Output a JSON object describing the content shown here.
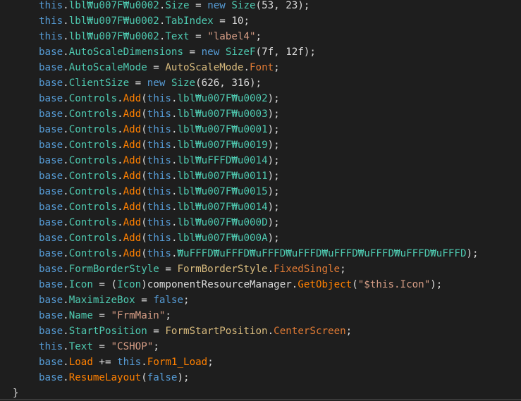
{
  "editor": {
    "lines": [
      [
        {
          "t": "this",
          "c": "kw"
        },
        {
          "t": ".",
          "c": "plain"
        },
        {
          "t": "lbl₩u007F₩u0002",
          "c": "member"
        },
        {
          "t": ".",
          "c": "plain"
        },
        {
          "t": "Size",
          "c": "prop"
        },
        {
          "t": " = ",
          "c": "plain"
        },
        {
          "t": "new",
          "c": "kw"
        },
        {
          "t": " ",
          "c": "plain"
        },
        {
          "t": "Size",
          "c": "type"
        },
        {
          "t": "(53, 23);",
          "c": "plain"
        }
      ],
      [
        {
          "t": "this",
          "c": "kw"
        },
        {
          "t": ".",
          "c": "plain"
        },
        {
          "t": "lbl₩u007F₩u0002",
          "c": "member"
        },
        {
          "t": ".",
          "c": "plain"
        },
        {
          "t": "TabIndex",
          "c": "prop"
        },
        {
          "t": " = 10;",
          "c": "plain"
        }
      ],
      [
        {
          "t": "this",
          "c": "kw"
        },
        {
          "t": ".",
          "c": "plain"
        },
        {
          "t": "lbl₩u007F₩u0002",
          "c": "member"
        },
        {
          "t": ".",
          "c": "plain"
        },
        {
          "t": "Text",
          "c": "prop"
        },
        {
          "t": " = ",
          "c": "plain"
        },
        {
          "t": "\"label4\"",
          "c": "str"
        },
        {
          "t": ";",
          "c": "plain"
        }
      ],
      [
        {
          "t": "base",
          "c": "kw"
        },
        {
          "t": ".",
          "c": "plain"
        },
        {
          "t": "AutoScaleDimensions",
          "c": "prop"
        },
        {
          "t": " = ",
          "c": "plain"
        },
        {
          "t": "new",
          "c": "kw"
        },
        {
          "t": " ",
          "c": "plain"
        },
        {
          "t": "SizeF",
          "c": "type"
        },
        {
          "t": "(7f, 12f);",
          "c": "plain"
        }
      ],
      [
        {
          "t": "base",
          "c": "kw"
        },
        {
          "t": ".",
          "c": "plain"
        },
        {
          "t": "AutoScaleMode",
          "c": "prop"
        },
        {
          "t": " = ",
          "c": "plain"
        },
        {
          "t": "AutoScaleMode",
          "c": "ref"
        },
        {
          "t": ".",
          "c": "plain"
        },
        {
          "t": "Font",
          "c": "enum"
        },
        {
          "t": ";",
          "c": "plain"
        }
      ],
      [
        {
          "t": "base",
          "c": "kw"
        },
        {
          "t": ".",
          "c": "plain"
        },
        {
          "t": "ClientSize",
          "c": "prop"
        },
        {
          "t": " = ",
          "c": "plain"
        },
        {
          "t": "new",
          "c": "kw"
        },
        {
          "t": " ",
          "c": "plain"
        },
        {
          "t": "Size",
          "c": "type"
        },
        {
          "t": "(626, 316);",
          "c": "plain"
        }
      ],
      [
        {
          "t": "base",
          "c": "kw"
        },
        {
          "t": ".",
          "c": "plain"
        },
        {
          "t": "Controls",
          "c": "prop"
        },
        {
          "t": ".",
          "c": "plain"
        },
        {
          "t": "Add",
          "c": "method"
        },
        {
          "t": "(",
          "c": "plain"
        },
        {
          "t": "this",
          "c": "kw"
        },
        {
          "t": ".",
          "c": "plain"
        },
        {
          "t": "lbl₩u007F₩u0002",
          "c": "member"
        },
        {
          "t": ");",
          "c": "plain"
        }
      ],
      [
        {
          "t": "base",
          "c": "kw"
        },
        {
          "t": ".",
          "c": "plain"
        },
        {
          "t": "Controls",
          "c": "prop"
        },
        {
          "t": ".",
          "c": "plain"
        },
        {
          "t": "Add",
          "c": "method"
        },
        {
          "t": "(",
          "c": "plain"
        },
        {
          "t": "this",
          "c": "kw"
        },
        {
          "t": ".",
          "c": "plain"
        },
        {
          "t": "lbl₩u007F₩u0003",
          "c": "member"
        },
        {
          "t": ");",
          "c": "plain"
        }
      ],
      [
        {
          "t": "base",
          "c": "kw"
        },
        {
          "t": ".",
          "c": "plain"
        },
        {
          "t": "Controls",
          "c": "prop"
        },
        {
          "t": ".",
          "c": "plain"
        },
        {
          "t": "Add",
          "c": "method"
        },
        {
          "t": "(",
          "c": "plain"
        },
        {
          "t": "this",
          "c": "kw"
        },
        {
          "t": ".",
          "c": "plain"
        },
        {
          "t": "lbl₩u007F₩u0001",
          "c": "member"
        },
        {
          "t": ");",
          "c": "plain"
        }
      ],
      [
        {
          "t": "base",
          "c": "kw"
        },
        {
          "t": ".",
          "c": "plain"
        },
        {
          "t": "Controls",
          "c": "prop"
        },
        {
          "t": ".",
          "c": "plain"
        },
        {
          "t": "Add",
          "c": "method"
        },
        {
          "t": "(",
          "c": "plain"
        },
        {
          "t": "this",
          "c": "kw"
        },
        {
          "t": ".",
          "c": "plain"
        },
        {
          "t": "lbl₩u007F₩u0019",
          "c": "member"
        },
        {
          "t": ");",
          "c": "plain"
        }
      ],
      [
        {
          "t": "base",
          "c": "kw"
        },
        {
          "t": ".",
          "c": "plain"
        },
        {
          "t": "Controls",
          "c": "prop"
        },
        {
          "t": ".",
          "c": "plain"
        },
        {
          "t": "Add",
          "c": "method"
        },
        {
          "t": "(",
          "c": "plain"
        },
        {
          "t": "this",
          "c": "kw"
        },
        {
          "t": ".",
          "c": "plain"
        },
        {
          "t": "lbl₩uFFFD₩u0014",
          "c": "member"
        },
        {
          "t": ");",
          "c": "plain"
        }
      ],
      [
        {
          "t": "base",
          "c": "kw"
        },
        {
          "t": ".",
          "c": "plain"
        },
        {
          "t": "Controls",
          "c": "prop"
        },
        {
          "t": ".",
          "c": "plain"
        },
        {
          "t": "Add",
          "c": "method"
        },
        {
          "t": "(",
          "c": "plain"
        },
        {
          "t": "this",
          "c": "kw"
        },
        {
          "t": ".",
          "c": "plain"
        },
        {
          "t": "lbl₩u007F₩u0011",
          "c": "member"
        },
        {
          "t": ");",
          "c": "plain"
        }
      ],
      [
        {
          "t": "base",
          "c": "kw"
        },
        {
          "t": ".",
          "c": "plain"
        },
        {
          "t": "Controls",
          "c": "prop"
        },
        {
          "t": ".",
          "c": "plain"
        },
        {
          "t": "Add",
          "c": "method"
        },
        {
          "t": "(",
          "c": "plain"
        },
        {
          "t": "this",
          "c": "kw"
        },
        {
          "t": ".",
          "c": "plain"
        },
        {
          "t": "lbl₩u007F₩u0015",
          "c": "member"
        },
        {
          "t": ");",
          "c": "plain"
        }
      ],
      [
        {
          "t": "base",
          "c": "kw"
        },
        {
          "t": ".",
          "c": "plain"
        },
        {
          "t": "Controls",
          "c": "prop"
        },
        {
          "t": ".",
          "c": "plain"
        },
        {
          "t": "Add",
          "c": "method"
        },
        {
          "t": "(",
          "c": "plain"
        },
        {
          "t": "this",
          "c": "kw"
        },
        {
          "t": ".",
          "c": "plain"
        },
        {
          "t": "lbl₩u007F₩u0014",
          "c": "member"
        },
        {
          "t": ");",
          "c": "plain"
        }
      ],
      [
        {
          "t": "base",
          "c": "kw"
        },
        {
          "t": ".",
          "c": "plain"
        },
        {
          "t": "Controls",
          "c": "prop"
        },
        {
          "t": ".",
          "c": "plain"
        },
        {
          "t": "Add",
          "c": "method"
        },
        {
          "t": "(",
          "c": "plain"
        },
        {
          "t": "this",
          "c": "kw"
        },
        {
          "t": ".",
          "c": "plain"
        },
        {
          "t": "lbl₩u007F₩u000D",
          "c": "member"
        },
        {
          "t": ");",
          "c": "plain"
        }
      ],
      [
        {
          "t": "base",
          "c": "kw"
        },
        {
          "t": ".",
          "c": "plain"
        },
        {
          "t": "Controls",
          "c": "prop"
        },
        {
          "t": ".",
          "c": "plain"
        },
        {
          "t": "Add",
          "c": "method"
        },
        {
          "t": "(",
          "c": "plain"
        },
        {
          "t": "this",
          "c": "kw"
        },
        {
          "t": ".",
          "c": "plain"
        },
        {
          "t": "lbl₩u007F₩u000A",
          "c": "member"
        },
        {
          "t": ");",
          "c": "plain"
        }
      ],
      [
        {
          "t": "base",
          "c": "kw"
        },
        {
          "t": ".",
          "c": "plain"
        },
        {
          "t": "Controls",
          "c": "prop"
        },
        {
          "t": ".",
          "c": "plain"
        },
        {
          "t": "Add",
          "c": "method"
        },
        {
          "t": "(",
          "c": "plain"
        },
        {
          "t": "this",
          "c": "kw"
        },
        {
          "t": ".",
          "c": "plain"
        },
        {
          "t": "₩uFFFD₩uFFFD₩uFFFD₩uFFFD₩uFFFD₩uFFFD₩uFFFD₩uFFFD",
          "c": "member"
        },
        {
          "t": ");",
          "c": "plain"
        }
      ],
      [
        {
          "t": "base",
          "c": "kw"
        },
        {
          "t": ".",
          "c": "plain"
        },
        {
          "t": "FormBorderStyle",
          "c": "prop"
        },
        {
          "t": " = ",
          "c": "plain"
        },
        {
          "t": "FormBorderStyle",
          "c": "ref"
        },
        {
          "t": ".",
          "c": "plain"
        },
        {
          "t": "FixedSingle",
          "c": "enum"
        },
        {
          "t": ";",
          "c": "plain"
        }
      ],
      [
        {
          "t": "base",
          "c": "kw"
        },
        {
          "t": ".",
          "c": "plain"
        },
        {
          "t": "Icon",
          "c": "prop"
        },
        {
          "t": " = (",
          "c": "plain"
        },
        {
          "t": "Icon",
          "c": "type"
        },
        {
          "t": ")componentResourceManager.",
          "c": "plain"
        },
        {
          "t": "GetObject",
          "c": "method"
        },
        {
          "t": "(",
          "c": "plain"
        },
        {
          "t": "\"$this.Icon\"",
          "c": "str"
        },
        {
          "t": ");",
          "c": "plain"
        }
      ],
      [
        {
          "t": "base",
          "c": "kw"
        },
        {
          "t": ".",
          "c": "plain"
        },
        {
          "t": "MaximizeBox",
          "c": "prop"
        },
        {
          "t": " = ",
          "c": "plain"
        },
        {
          "t": "false",
          "c": "kw"
        },
        {
          "t": ";",
          "c": "plain"
        }
      ],
      [
        {
          "t": "base",
          "c": "kw"
        },
        {
          "t": ".",
          "c": "plain"
        },
        {
          "t": "Name",
          "c": "prop"
        },
        {
          "t": " = ",
          "c": "plain"
        },
        {
          "t": "\"FrmMain\"",
          "c": "str"
        },
        {
          "t": ";",
          "c": "plain"
        }
      ],
      [
        {
          "t": "base",
          "c": "kw"
        },
        {
          "t": ".",
          "c": "plain"
        },
        {
          "t": "StartPosition",
          "c": "prop"
        },
        {
          "t": " = ",
          "c": "plain"
        },
        {
          "t": "FormStartPosition",
          "c": "ref"
        },
        {
          "t": ".",
          "c": "plain"
        },
        {
          "t": "CenterScreen",
          "c": "enum"
        },
        {
          "t": ";",
          "c": "plain"
        }
      ],
      [
        {
          "t": "this",
          "c": "kw"
        },
        {
          "t": ".",
          "c": "plain"
        },
        {
          "t": "Text",
          "c": "prop"
        },
        {
          "t": " = ",
          "c": "plain"
        },
        {
          "t": "\"CSHOP\"",
          "c": "str"
        },
        {
          "t": ";",
          "c": "plain"
        }
      ],
      [
        {
          "t": "base",
          "c": "kw"
        },
        {
          "t": ".",
          "c": "plain"
        },
        {
          "t": "Load",
          "c": "method"
        },
        {
          "t": " += ",
          "c": "plain"
        },
        {
          "t": "this",
          "c": "kw"
        },
        {
          "t": ".",
          "c": "plain"
        },
        {
          "t": "Form1_Load",
          "c": "method"
        },
        {
          "t": ";",
          "c": "plain"
        }
      ],
      [
        {
          "t": "base",
          "c": "kw"
        },
        {
          "t": ".",
          "c": "plain"
        },
        {
          "t": "ResumeLayout",
          "c": "method"
        },
        {
          "t": "(",
          "c": "plain"
        },
        {
          "t": "false",
          "c": "kw"
        },
        {
          "t": ");",
          "c": "plain"
        }
      ]
    ],
    "closing_brace": "}"
  },
  "colors": {
    "background": "#1e1e1e",
    "keyword": "#569cd6",
    "member": "#4ec9b0",
    "string": "#d69d85",
    "method": "#ff8000",
    "plain": "#dcdcdc"
  }
}
